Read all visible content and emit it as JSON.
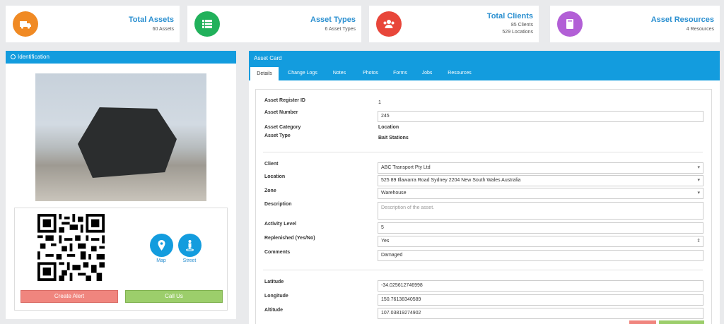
{
  "stats": [
    {
      "title": "Total Assets",
      "sub1": "60 Assets",
      "sub2": "",
      "color": "#f08a24",
      "icon": "truck-icon"
    },
    {
      "title": "Asset Types",
      "sub1": "6 Asset Types",
      "sub2": "",
      "color": "#21b15b",
      "icon": "list-icon"
    },
    {
      "title": "Total Clients",
      "sub1": "85 Clients",
      "sub2": "529 Locations",
      "color": "#e8463a",
      "icon": "users-icon"
    },
    {
      "title": "Asset Resources",
      "sub1": "4 Resources",
      "sub2": "",
      "color": "#b25fd6",
      "icon": "book-icon"
    }
  ],
  "identification": {
    "title": "Identification",
    "map_label": "Map",
    "street_label": "Street",
    "create_alert": "Create Alert",
    "call_us": "Call Us"
  },
  "asset_card": {
    "title": "Asset Card",
    "tabs": [
      "Details",
      "Change Logs",
      "Notes",
      "Photos",
      "Forms",
      "Jobs",
      "Resources"
    ],
    "active_tab": "Details"
  },
  "details": {
    "register_id_label": "Asset Register ID",
    "register_id": "1",
    "asset_number_label": "Asset Number",
    "asset_number": "245",
    "category_label": "Asset Category",
    "category": "Location",
    "type_label": "Asset Type",
    "type": "Bait Stations",
    "client_label": "Client",
    "client": "ABC Transport Pty Ltd",
    "location_label": "Location",
    "location": "525 89 Illawarra Road Sydney 2204 New South Wales Australia",
    "zone_label": "Zone",
    "zone": "Warehouse",
    "description_label": "Description",
    "description_placeholder": "Description of the asset.",
    "activity_label": "Activity Level",
    "activity": "5",
    "replenished_label": "Replenished (Yes/No)",
    "replenished": "Yes",
    "comments_label": "Comments",
    "comments": "Damaged",
    "latitude_label": "Latitude",
    "latitude": "-34.025612746998",
    "longitude_label": "Longitude",
    "longitude": "150.76138340589",
    "altitude_label": "Altitude",
    "altitude": "107.03819274902"
  },
  "colors": {
    "accent": "#139cde",
    "danger": "#f0857e",
    "success": "#9cce6b"
  }
}
